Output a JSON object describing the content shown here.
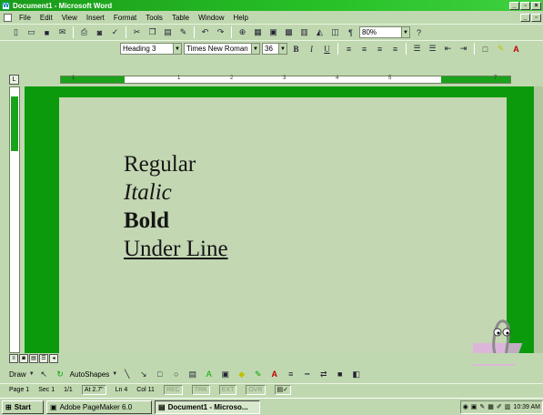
{
  "window": {
    "title": "Document1 - Microsoft Word"
  },
  "menu": [
    "File",
    "Edit",
    "View",
    "Insert",
    "Format",
    "Tools",
    "Table",
    "Window",
    "Help"
  ],
  "standard_toolbar": {
    "icons": [
      "new-icon",
      "open-icon",
      "save-icon",
      "email-icon",
      "print-icon",
      "print-preview-icon",
      "spelling-icon",
      "cut-icon",
      "copy-icon",
      "paste-icon",
      "format-painter-icon",
      "undo-icon",
      "redo-icon",
      "hyperlink-icon",
      "tables-borders-icon",
      "insert-table-icon",
      "insert-excel-icon",
      "columns-icon",
      "drawing-icon",
      "document-map-icon",
      "show-hide-icon"
    ],
    "zoom": "80%",
    "show_hide_glyph": "¶",
    "help_glyph": "?"
  },
  "format_toolbar": {
    "style": "Heading 3",
    "font": "Times New Roman",
    "size": "36",
    "bold_label": "B",
    "italic_label": "I",
    "underline_label": "U"
  },
  "ruler": {
    "numbers": [
      "1",
      "1",
      "2",
      "3",
      "4",
      "5",
      "6",
      "7"
    ],
    "corner": "L"
  },
  "document": {
    "lines": [
      "Regular",
      "Italic",
      "Bold",
      "Under Line"
    ]
  },
  "drawing_toolbar": {
    "draw_label": "Draw",
    "autoshapes_label": "AutoShapes"
  },
  "status": {
    "page": "Page 1",
    "sec": "Sec 1",
    "pages": "1/1",
    "at": "At 2.7\"",
    "ln": "Ln 4",
    "col": "Col 11",
    "modes": [
      "REC",
      "TRK",
      "EXT",
      "OVR"
    ]
  },
  "taskbar": {
    "start_label": "Start",
    "tasks": [
      "Adobe PageMaker 6.0",
      "Document1 - Microso..."
    ],
    "clock": "10:39 AM"
  },
  "colors": {
    "title_green": "#1a9a1a",
    "workspace_green": "#0b9a0b",
    "page_bg": "#c3d7b2",
    "chrome_bg": "#c0d8b0"
  }
}
